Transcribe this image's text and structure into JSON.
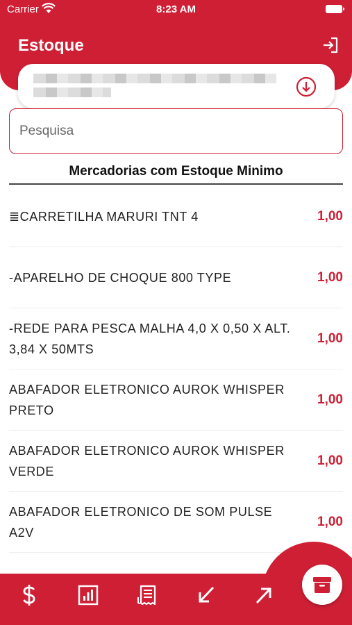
{
  "status_bar": {
    "carrier": "Carrier",
    "time": "8:23 AM"
  },
  "header": {
    "title": "Estoque"
  },
  "search": {
    "placeholder": "Pesquisa"
  },
  "section": {
    "title": "Mercadorias com Estoque Minimo"
  },
  "items": [
    {
      "name": "≣CARRETILHA MARURI TNT 4",
      "qty": "1,00"
    },
    {
      "name": "-APARELHO DE CHOQUE 800 TYPE",
      "qty": "1,00"
    },
    {
      "name": "-REDE PARA PESCA MALHA 4,0 X 0,50 X ALT. 3,84  X 50MTS",
      "qty": "1,00"
    },
    {
      "name": "ABAFADOR ELETRONICO AUROK WHISPER PRETO",
      "qty": "1,00"
    },
    {
      "name": "ABAFADOR ELETRONICO AUROK WHISPER VERDE",
      "qty": "1,00"
    },
    {
      "name": "ABAFADOR ELETRONICO DE SOM PULSE A2V",
      "qty": "1,00"
    }
  ],
  "nav": [
    "dollar-icon",
    "report-icon",
    "receipt-icon",
    "arrow-down-left-icon",
    "arrow-up-right-icon",
    "archive-icon"
  ],
  "colors": {
    "accent": "#cf1f35",
    "background": "#ffffff"
  }
}
